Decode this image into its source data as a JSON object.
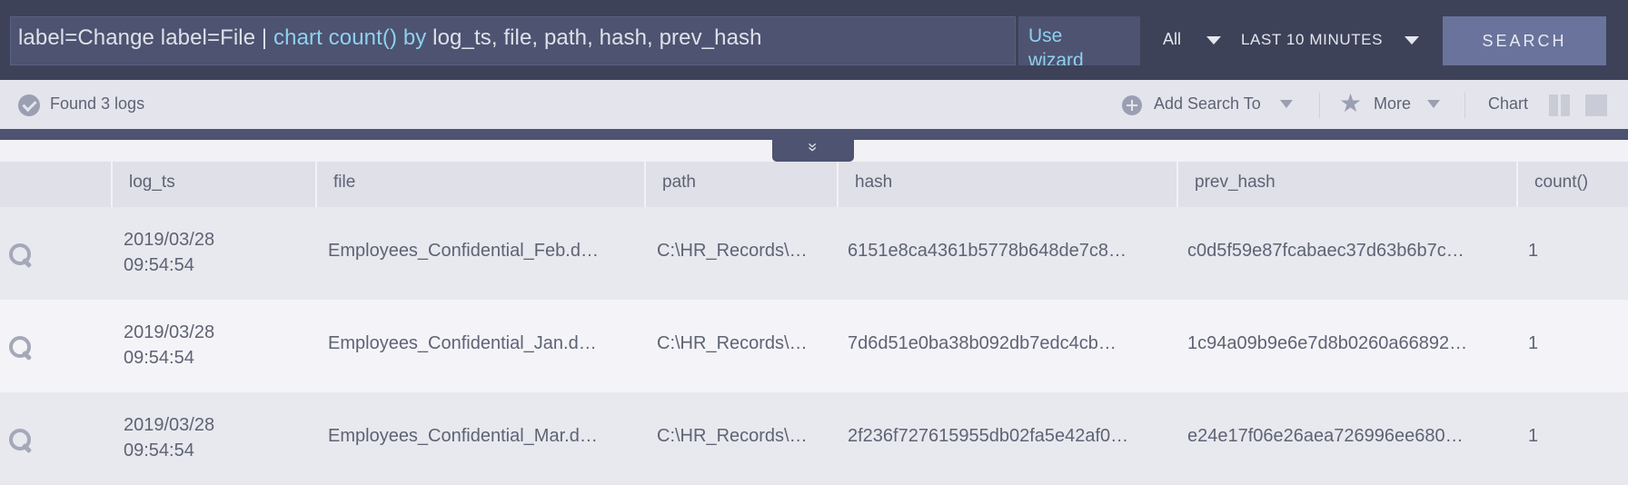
{
  "query": {
    "part1": "label=Change label=File | ",
    "kw1": "chart count()",
    "part2": " ",
    "kw2": "by",
    "part3": " log_ts, file, path, hash, prev_hash"
  },
  "toolbar": {
    "wizard_label": "Use wizard",
    "scope_value": "All",
    "range_value": "LAST 10 MINUTES",
    "search_label": "SEARCH"
  },
  "status": {
    "found_text": "Found 3 logs",
    "add_search_label": "Add Search To",
    "more_label": "More",
    "chart_label": "Chart",
    "collapse_glyph": "»"
  },
  "table": {
    "columns": [
      "log_ts",
      "file",
      "path",
      "hash",
      "prev_hash",
      "count()"
    ],
    "rows": [
      {
        "log_ts": "2019/03/28 09:54:54",
        "file": "Employees_Confidential_Feb.d…",
        "path": "C:\\HR_Records\\…",
        "hash": "6151e8ca4361b5778b648de7c8…",
        "prev_hash": "c0d5f59e87fcabaec37d63b6b7c…",
        "count": "1"
      },
      {
        "log_ts": "2019/03/28 09:54:54",
        "file": "Employees_Confidential_Jan.d…",
        "path": "C:\\HR_Records\\…",
        "hash": "7d6d51e0ba38b092db7edc4cb…",
        "prev_hash": "1c94a09b9e6e7d8b0260a66892…",
        "count": "1"
      },
      {
        "log_ts": "2019/03/28 09:54:54",
        "file": "Employees_Confidential_Mar.d…",
        "path": "C:\\HR_Records\\…",
        "hash": "2f236f727615955db02fa5e42af0…",
        "prev_hash": "e24e17f06e26aea726996ee680…",
        "count": "1"
      }
    ]
  },
  "icons": [
    "check-circle-icon",
    "chevron-down-icon",
    "plus-circle-icon",
    "star-icon",
    "split-view-icon",
    "single-view-icon",
    "double-chevron-down-icon",
    "search-icon"
  ],
  "colors": {
    "topbar": "#3d4259",
    "accent_text": "#8fd0f0",
    "search_button": "#6a739b"
  }
}
